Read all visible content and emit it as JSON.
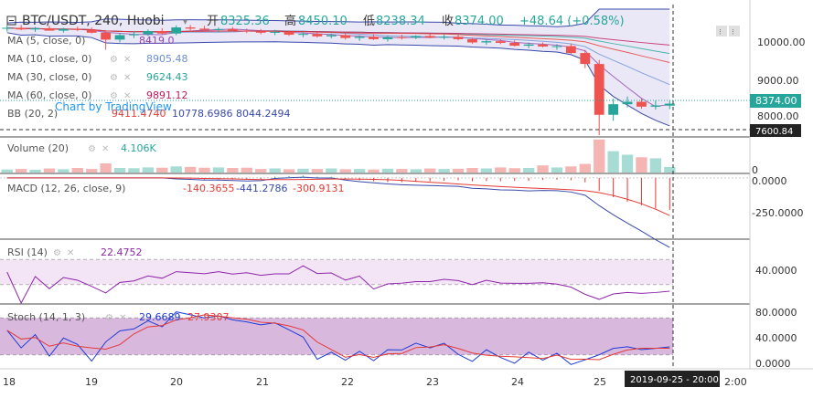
{
  "header": {
    "symbol": "BTC/USDT, 240, Huobi",
    "open_label": "开",
    "open": "8325.36",
    "high_label": "高",
    "high": "8450.10",
    "low_label": "低",
    "low": "8238.34",
    "close_label": "收",
    "close": "8374.00",
    "change": "+48.64 (+0.58%)"
  },
  "indicators": [
    {
      "label": "MA (5, close, 0)",
      "value": "8419.0",
      "color": "#8e44ad"
    },
    {
      "label": "MA (10, close, 0)",
      "value": "8905.48",
      "color": "#6a8fd6"
    },
    {
      "label": "MA (30, close, 0)",
      "value": "9624.43",
      "color": "#26a69a"
    },
    {
      "label": "MA (60, close, 0)",
      "value": "9891.12",
      "color": "#c2185b"
    },
    {
      "label": "BB (20, 2)",
      "values": [
        "9411.4740",
        "10778.6986",
        "8044.2494"
      ],
      "colors": [
        "#e53935",
        "#3949ab",
        "#3949ab"
      ]
    }
  ],
  "watermark": "Chart by TradingView",
  "price_axis": {
    "ticks": [
      "10000.00",
      "9000.00",
      "8000.00"
    ],
    "last_price": "8374.00",
    "cursor_price": "7600.84"
  },
  "volume": {
    "label": "Volume (20)",
    "value": "4.106K",
    "tick": "0"
  },
  "macd": {
    "label": "MACD (12, 26, close, 9)",
    "values": [
      "-140.3655",
      "-441.2786",
      "-300.9131"
    ],
    "ticks": [
      "0.0000",
      "-250.0000"
    ]
  },
  "rsi": {
    "label": "RSI (14)",
    "value": "22.4752",
    "tick": "40.0000"
  },
  "stoch": {
    "label": "Stoch (14, 1, 3)",
    "values": [
      "29.6689",
      "27.9307"
    ],
    "ticks": [
      "80.0000",
      "40.0000",
      "0.0000"
    ]
  },
  "time_axis": {
    "ticks": [
      "18",
      "19",
      "20",
      "21",
      "22",
      "23",
      "24",
      "25",
      "2:00"
    ],
    "cursor": "2019-09-25 - 20:00"
  },
  "colors": {
    "up": "#26a69a",
    "down": "#ef5350",
    "background": "#ffffff",
    "bollinger_fill": "#e8e6f5",
    "rsi_fill": "#f3e5f5",
    "stoch_fill": "#d9b8de",
    "panel_border": "#4a4a4a"
  },
  "chart_data": {
    "type": "candlestick",
    "interval": "240 minutes",
    "x_range": [
      "2019-09-18",
      "2019-09-25"
    ],
    "candles": [
      {
        "t": "09-18",
        "o": 10220,
        "h": 10300,
        "l": 10150,
        "c": 10240
      },
      {
        "t": "09-18",
        "o": 10240,
        "h": 10310,
        "l": 10180,
        "c": 10200
      },
      {
        "t": "09-18",
        "o": 10200,
        "h": 10260,
        "l": 10140,
        "c": 10230
      },
      {
        "t": "09-18",
        "o": 10230,
        "h": 10290,
        "l": 10180,
        "c": 10170
      },
      {
        "t": "09-18",
        "o": 10170,
        "h": 10240,
        "l": 10120,
        "c": 10210
      },
      {
        "t": "09-18",
        "o": 10210,
        "h": 10270,
        "l": 10160,
        "c": 10190
      },
      {
        "t": "09-19",
        "o": 10190,
        "h": 10250,
        "l": 10100,
        "c": 10120
      },
      {
        "t": "09-19",
        "o": 10120,
        "h": 10180,
        "l": 9700,
        "c": 9950
      },
      {
        "t": "09-19",
        "o": 9950,
        "h": 10100,
        "l": 9880,
        "c": 10060
      },
      {
        "t": "09-19",
        "o": 10060,
        "h": 10150,
        "l": 9990,
        "c": 10080
      },
      {
        "t": "09-19",
        "o": 10080,
        "h": 10200,
        "l": 10040,
        "c": 10160
      },
      {
        "t": "09-19",
        "o": 10160,
        "h": 10230,
        "l": 10080,
        "c": 10100
      },
      {
        "t": "09-20",
        "o": 10100,
        "h": 10300,
        "l": 10060,
        "c": 10250
      },
      {
        "t": "09-20",
        "o": 10250,
        "h": 10310,
        "l": 10180,
        "c": 10220
      },
      {
        "t": "09-20",
        "o": 10220,
        "h": 10290,
        "l": 10160,
        "c": 10190
      },
      {
        "t": "09-20",
        "o": 10190,
        "h": 10250,
        "l": 10130,
        "c": 10210
      },
      {
        "t": "09-20",
        "o": 10210,
        "h": 10260,
        "l": 10150,
        "c": 10170
      },
      {
        "t": "09-20",
        "o": 10170,
        "h": 10220,
        "l": 10110,
        "c": 10150
      },
      {
        "t": "09-21",
        "o": 10150,
        "h": 10210,
        "l": 10080,
        "c": 10120
      },
      {
        "t": "09-21",
        "o": 10120,
        "h": 10190,
        "l": 10060,
        "c": 10140
      },
      {
        "t": "09-21",
        "o": 10140,
        "h": 10180,
        "l": 10040,
        "c": 10070
      },
      {
        "t": "09-21",
        "o": 10070,
        "h": 10130,
        "l": 10010,
        "c": 10090
      },
      {
        "t": "09-21",
        "o": 10090,
        "h": 10140,
        "l": 10000,
        "c": 10030
      },
      {
        "t": "09-21",
        "o": 10030,
        "h": 10100,
        "l": 9980,
        "c": 10060
      },
      {
        "t": "09-22",
        "o": 10060,
        "h": 10110,
        "l": 9950,
        "c": 9990
      },
      {
        "t": "09-22",
        "o": 9990,
        "h": 10060,
        "l": 9920,
        "c": 10020
      },
      {
        "t": "09-22",
        "o": 10020,
        "h": 10080,
        "l": 9940,
        "c": 9960
      },
      {
        "t": "09-22",
        "o": 9960,
        "h": 10040,
        "l": 9900,
        "c": 10010
      },
      {
        "t": "09-22",
        "o": 10010,
        "h": 10070,
        "l": 9950,
        "c": 10000
      },
      {
        "t": "09-22",
        "o": 10000,
        "h": 10060,
        "l": 9960,
        "c": 10040
      },
      {
        "t": "09-23",
        "o": 10040,
        "h": 10100,
        "l": 9980,
        "c": 10000
      },
      {
        "t": "09-23",
        "o": 10000,
        "h": 10080,
        "l": 9950,
        "c": 10020
      },
      {
        "t": "09-23",
        "o": 10020,
        "h": 10070,
        "l": 9930,
        "c": 9960
      },
      {
        "t": "09-23",
        "o": 9960,
        "h": 10000,
        "l": 9850,
        "c": 9880
      },
      {
        "t": "09-23",
        "o": 9880,
        "h": 9950,
        "l": 9820,
        "c": 9910
      },
      {
        "t": "09-23",
        "o": 9910,
        "h": 9960,
        "l": 9840,
        "c": 9870
      },
      {
        "t": "09-24",
        "o": 9870,
        "h": 9930,
        "l": 9780,
        "c": 9800
      },
      {
        "t": "09-24",
        "o": 9800,
        "h": 9880,
        "l": 9740,
        "c": 9830
      },
      {
        "t": "09-24",
        "o": 9830,
        "h": 9880,
        "l": 9760,
        "c": 9780
      },
      {
        "t": "09-24",
        "o": 9780,
        "h": 9840,
        "l": 9700,
        "c": 9790
      },
      {
        "t": "09-24",
        "o": 9790,
        "h": 9850,
        "l": 9600,
        "c": 9620
      },
      {
        "t": "09-24",
        "o": 9620,
        "h": 9700,
        "l": 9250,
        "c": 9350
      },
      {
        "t": "09-25",
        "o": 9350,
        "h": 9450,
        "l": 7600,
        "c": 8100
      },
      {
        "t": "09-25",
        "o": 8100,
        "h": 8500,
        "l": 7950,
        "c": 8360
      },
      {
        "t": "09-25",
        "o": 8360,
        "h": 8550,
        "l": 8280,
        "c": 8420
      },
      {
        "t": "09-25",
        "o": 8420,
        "h": 8500,
        "l": 8250,
        "c": 8300
      },
      {
        "t": "09-25",
        "o": 8300,
        "h": 8450,
        "l": 8230,
        "c": 8330
      },
      {
        "t": "09-25",
        "o": 8325,
        "h": 8450,
        "l": 8238,
        "c": 8374
      }
    ],
    "price_range": [
      7600,
      10700
    ],
    "volume_range": [
      0,
      7000
    ],
    "volume": [
      600,
      700,
      550,
      800,
      650,
      900,
      700,
      1800,
      900,
      850,
      1000,
      950,
      1200,
      1100,
      950,
      1000,
      900,
      950,
      700,
      800,
      650,
      750,
      700,
      800,
      650,
      700,
      600,
      750,
      700,
      650,
      800,
      700,
      750,
      900,
      800,
      1000,
      850,
      900,
      1400,
      1000,
      1200,
      1700,
      6500,
      4200,
      3500,
      3000,
      2800,
      1100
    ],
    "macd_range": [
      -450,
      20
    ],
    "rsi_range": [
      0,
      100
    ],
    "rsi_band": [
      30,
      70
    ],
    "stoch_range": [
      0,
      100
    ],
    "stoch_band": [
      20,
      80
    ]
  }
}
